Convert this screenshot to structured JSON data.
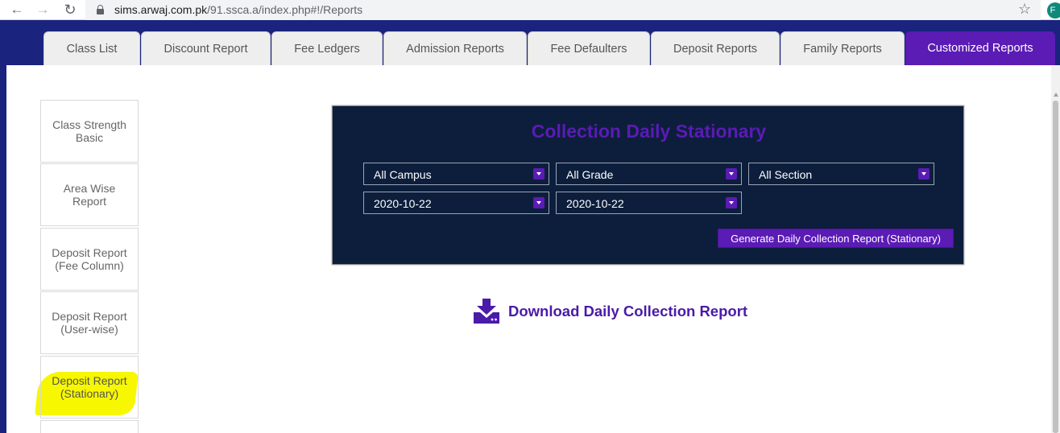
{
  "browser": {
    "url_domain": "sims.arwaj.com.pk",
    "url_path": "/91.ssca.a/index.php#!/Reports",
    "profile_initial": "F"
  },
  "tabs": [
    {
      "label": "Class List",
      "active": false
    },
    {
      "label": "Discount Report",
      "active": false
    },
    {
      "label": "Fee Ledgers",
      "active": false
    },
    {
      "label": "Admission Reports",
      "active": false
    },
    {
      "label": "Fee Defaulters",
      "active": false
    },
    {
      "label": "Deposit Reports",
      "active": false
    },
    {
      "label": "Family Reports",
      "active": false
    },
    {
      "label": "Customized Reports",
      "active": true
    }
  ],
  "sidebar": {
    "items": [
      {
        "label": "Class Strength Basic"
      },
      {
        "label": "Area Wise Report"
      },
      {
        "label": "Deposit Report (Fee Column)"
      },
      {
        "label": "Deposit Report (User-wise)"
      },
      {
        "label": "Deposit Report (Stationary)",
        "highlighted": true
      },
      {
        "label": ""
      }
    ]
  },
  "report": {
    "title": "Collection Daily Stationary",
    "filters": {
      "campus": "All Campus",
      "grade": "All Grade",
      "section": "All Section",
      "date_from": "2020-10-22",
      "date_to": "2020-10-22"
    },
    "generate_label": "Generate Daily Collection Report (Stationary)"
  },
  "download": {
    "label": "Download Daily Collection Report"
  },
  "colors": {
    "accent": "#5b1bb5",
    "page_bg": "#1a237e",
    "card_bg": "#0c1e3c",
    "highlight": "#f7f700"
  }
}
